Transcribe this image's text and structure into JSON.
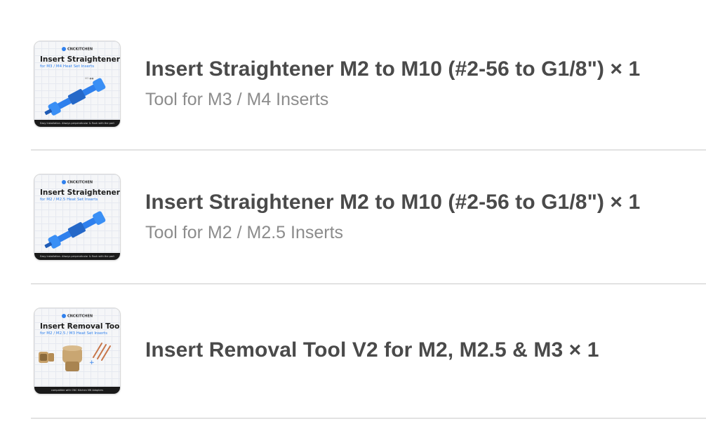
{
  "items": [
    {
      "title": "Insert Straightener M2 to M10 (#2-56 to G1/8\") × 1",
      "subtitle": "Tool for M3 / M4 Inserts",
      "thumb": {
        "brand": "CNCKITCHEN",
        "heading": "Insert Straightener",
        "subheading": "for M3 / M4 Heat Set Inserts",
        "footer": "Easy installation. Always perpendicular & flush with the part",
        "accent": "#2f80ed",
        "icon": "straightener-tool-image"
      }
    },
    {
      "title": "Insert Straightener M2 to M10 (#2-56 to G1/8\") × 1",
      "subtitle": "Tool for M2 / M2.5 Inserts",
      "thumb": {
        "brand": "CNCKITCHEN",
        "heading": "Insert Straightener",
        "subheading": "for M2 / M2.5 Heat Set Inserts",
        "footer": "Easy installation. Always perpendicular & flush with the part",
        "accent": "#2f80ed",
        "icon": "straightener-tool-image"
      }
    },
    {
      "title": "Insert Removal Tool V2 for M2, M2.5 & M3 × 1",
      "subtitle": "",
      "thumb": {
        "brand": "CNCKITCHEN",
        "heading": "Insert Removal Tool",
        "subheading": "for M2 / M2.5 / M3 Heat Set Inserts",
        "footer": "compatible with CNC Kitchen M6 Adapters",
        "accent": "#2f80ed",
        "icon": "removal-tool-image"
      }
    }
  ],
  "colors": {
    "title": "#4a4a4a",
    "subtitle": "#8c8c8c",
    "divider": "#e2e2e2"
  }
}
